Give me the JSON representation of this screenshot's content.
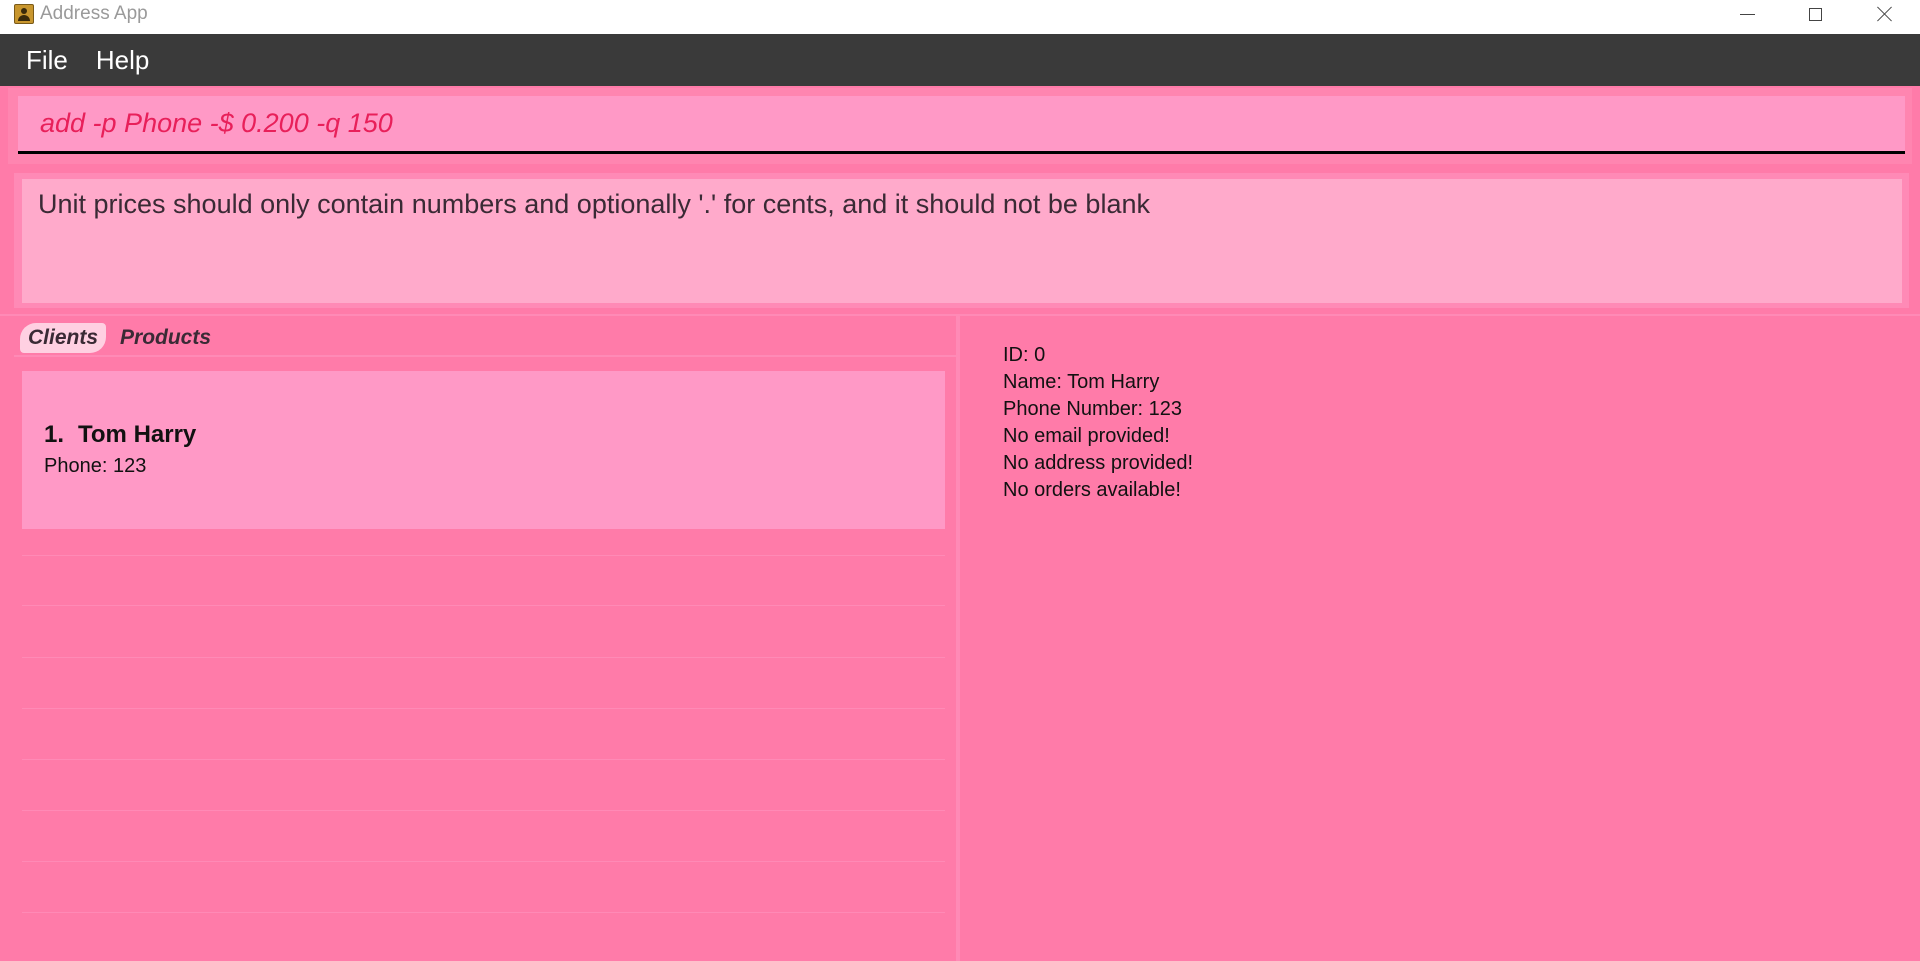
{
  "window": {
    "title": "Address App"
  },
  "menu": {
    "file": "File",
    "help": "Help"
  },
  "command": {
    "value": "add -p Phone -$ 0.200 -q 150"
  },
  "result": {
    "message": "Unit prices should only contain numbers and optionally '.' for cents, and it should not be blank"
  },
  "tabs": [
    {
      "label": "Clients",
      "active": true
    },
    {
      "label": "Products",
      "active": false
    }
  ],
  "clients": [
    {
      "index": "1.",
      "name": "Tom Harry",
      "phone": "Phone: 123"
    }
  ],
  "detail": {
    "id": "ID: 0",
    "name": "Name: Tom Harry",
    "phone": "Phone Number: 123",
    "email": "No email provided!",
    "address": "No address provided!",
    "orders": "No orders available!"
  },
  "colors": {
    "background": "#ff7ba9",
    "menubar": "#3a3a3a",
    "command_text": "#e8205a",
    "card": "#ff99c6",
    "result_box": "#ffaacb"
  }
}
